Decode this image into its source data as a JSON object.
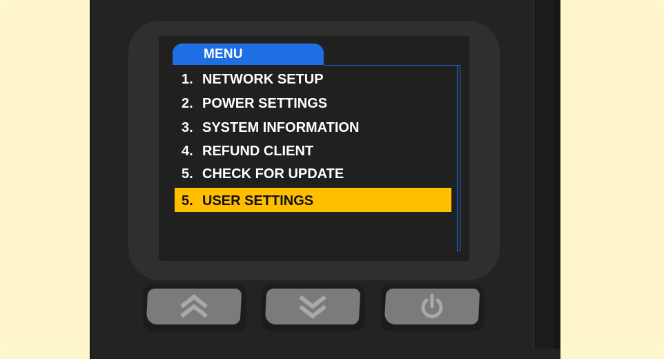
{
  "menu": {
    "title": "MENU",
    "items": [
      {
        "num": "1.",
        "label": "NETWORK SETUP"
      },
      {
        "num": "2.",
        "label": "POWER SETTINGS"
      },
      {
        "num": "3.",
        "label": "SYSTEM INFORMATION"
      },
      {
        "num": "4.",
        "label": "REFUND CLIENT"
      },
      {
        "num": "5.",
        "label": "CHECK FOR UPDATE"
      }
    ],
    "selected_item": {
      "num": "5.",
      "label": "USER SETTINGS"
    }
  },
  "buttons": {
    "up_icon": "double-chevron-up-icon",
    "down_icon": "double-chevron-down-icon",
    "power_icon": "power-icon"
  },
  "colors": {
    "accent": "#1f6fe3",
    "highlight": "#ffbf00",
    "background": "#fff5cc",
    "device": "#222423"
  }
}
